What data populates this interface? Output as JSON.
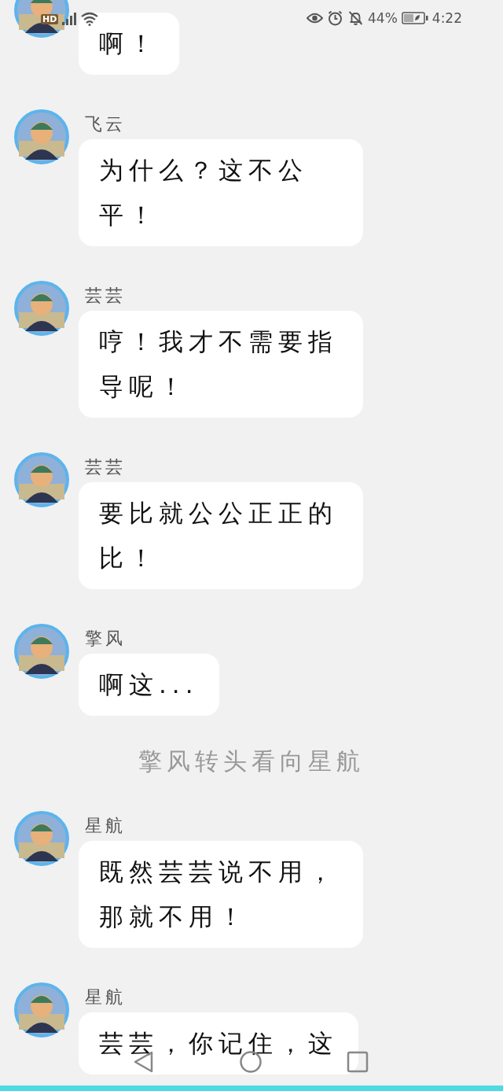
{
  "status_bar": {
    "network_badge": "HD",
    "battery": "44%",
    "time": "4:22"
  },
  "messages": [
    {
      "kind": "message",
      "text": "啊！"
    },
    {
      "kind": "message",
      "sender": "飞云",
      "text": "为什么？这不公平！"
    },
    {
      "kind": "message",
      "sender": "芸芸",
      "text": "哼！我才不需要指导呢！"
    },
    {
      "kind": "message",
      "sender": "芸芸",
      "text": "要比就公公正正的比！"
    },
    {
      "kind": "message",
      "sender": "擎风",
      "text": "啊这..."
    },
    {
      "kind": "narration",
      "text": "擎风转头看向星航"
    },
    {
      "kind": "message",
      "sender": "星航",
      "text": "既然芸芸说不用，那就不用！"
    },
    {
      "kind": "message",
      "sender": "星航",
      "text": "芸芸，你记住，这"
    }
  ]
}
